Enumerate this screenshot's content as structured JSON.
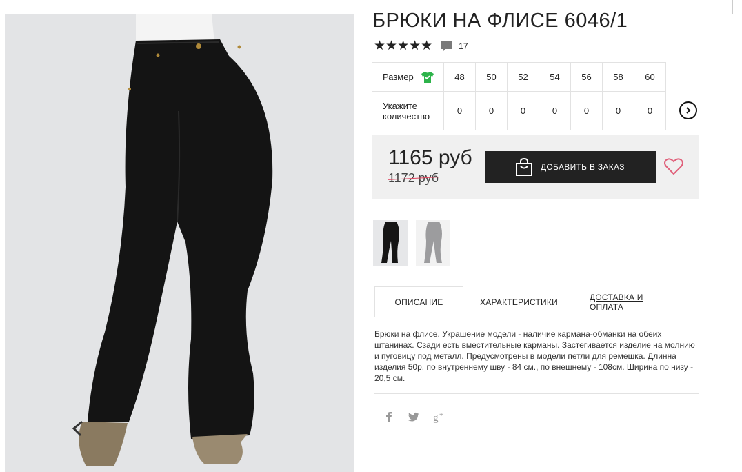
{
  "product": {
    "title": "БРЮКИ НА ФЛИСЕ 6046/1",
    "rating_stars": "★★★★★",
    "rating_value": 5,
    "review_count": "17"
  },
  "sizes": {
    "size_label": "Размер",
    "qty_label": "Укажите количество",
    "values": [
      "48",
      "50",
      "52",
      "54",
      "56",
      "58",
      "60"
    ],
    "quantities": [
      "0",
      "0",
      "0",
      "0",
      "0",
      "0",
      "0"
    ]
  },
  "pricing": {
    "price": "1165 руб",
    "old_price": "1172 руб",
    "add_button_label": "ДОБАВИТЬ В ЗАКАЗ"
  },
  "tabs": [
    {
      "label": "ОПИСАНИЕ",
      "active": true
    },
    {
      "label": "ХАРАКТЕРИСТИКИ",
      "active": false
    },
    {
      "label": "ДОСТАВКА И ОПЛАТА",
      "active": false
    }
  ],
  "description": "Брюки на флисе. Украшение модели - наличие кармана-обманки на обеих штанинах. Сзади есть вместительные карманы. Застегивается изделие на молнию и пуговицу под металл. Предусмотрены в модели петли для ремешка. Длинна изделия 50р. по внутреннему шву - 84 см., по внешнему - 108см. Ширина по низу - 20,5 см.",
  "icons": {
    "comment": "comment-icon",
    "size_chart": "tshirt-icon",
    "next": "chevron-right-icon",
    "bag": "shopping-bag-icon",
    "favorite": "heart-icon",
    "social": [
      "facebook-icon",
      "twitter-icon",
      "google-plus-icon"
    ]
  },
  "colors": {
    "accent": "#222222",
    "price_box_bg": "#f0f0f0",
    "heart": "#e0607a",
    "strike": "#e0455f",
    "size_icon": "#2db34a"
  }
}
